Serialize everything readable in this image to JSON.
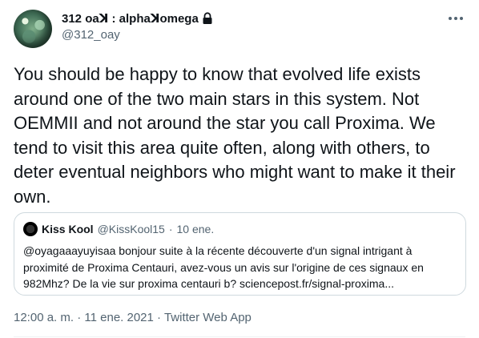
{
  "author": {
    "display_name": "312 oaꓘ : alphaꓘomega",
    "handle": "@312_oay",
    "locked": true
  },
  "icons": {
    "lock": "lock-icon",
    "more": "more-options-icon",
    "chevron": "chevron-down-icon"
  },
  "tweet": {
    "text": "You should be happy to know that evolved life exists around one of the two main stars in this system. Not OEMMII and not around the star you call Proxima. We tend to visit this area quite often, along with others, to deter eventual neighbors who might want to make it their own."
  },
  "quoted": {
    "name": "Kiss Kool",
    "handle": "@KissKool15",
    "separator": "·",
    "date": "10 ene.",
    "text": "@oyagaaayuyisaa bonjour suite à la récente découverte d'un signal intrigant à proximité de Proxima Centauri, avez-vous un avis sur l'origine de ces signaux en 982Mhz? De la vie sur proxima centauri b? sciencepost.fr/signal-proxima..."
  },
  "meta": {
    "time": "12:00 a. m.",
    "separator": "·",
    "date": "11 ene. 2021",
    "source": "Twitter Web App"
  },
  "colors": {
    "text": "#0f1419",
    "secondary": "#536471",
    "border": "#cfd9de"
  }
}
